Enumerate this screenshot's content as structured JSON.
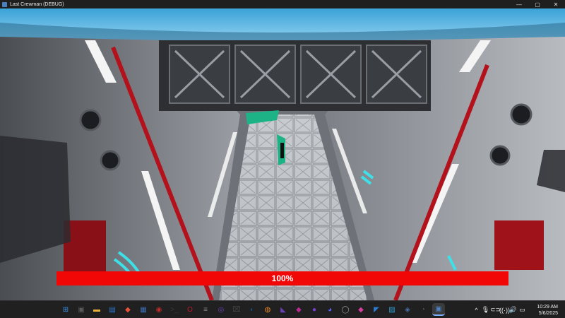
{
  "window": {
    "title": "Last Crewman (DEBUG)",
    "minimize": "—",
    "maximize": "▢",
    "close": "✕"
  },
  "hud": {
    "progress_label": "100%",
    "progress": 100,
    "bar_color": "#f20707"
  },
  "taskbar": {
    "icons": [
      {
        "name": "windows-start-icon",
        "glyph": "⊞",
        "color": "#3b8fe8"
      },
      {
        "name": "task-view-icon",
        "glyph": "▣",
        "color": "#5a5a5a"
      },
      {
        "name": "file-explorer-icon",
        "glyph": "▬",
        "color": "#e8b23b"
      },
      {
        "name": "notes-icon",
        "glyph": "▤",
        "color": "#2b79d6"
      },
      {
        "name": "brave-browser-icon",
        "glyph": "◆",
        "color": "#e8533b"
      },
      {
        "name": "calculator-icon",
        "glyph": "▦",
        "color": "#3c6fb5"
      },
      {
        "name": "app-red-icon",
        "glyph": "◉",
        "color": "#c22b2b"
      },
      {
        "name": "terminal-icon",
        "glyph": ">_",
        "color": "#3a3a3a"
      },
      {
        "name": "opera-icon",
        "glyph": "O",
        "color": "#c0172c"
      },
      {
        "name": "notepad-icon",
        "glyph": "≡",
        "color": "#8a8a8a"
      },
      {
        "name": "obs-icon",
        "glyph": "◎",
        "color": "#6a3fb5"
      },
      {
        "name": "capcut-icon",
        "glyph": "⌧",
        "color": "#444444"
      },
      {
        "name": "steam-icon",
        "glyph": "◐",
        "color": "#1b4b7a"
      },
      {
        "name": "blender-icon",
        "glyph": "◍",
        "color": "#e8872b"
      },
      {
        "name": "visual-studio-icon",
        "glyph": "◣",
        "color": "#6a3fb5"
      },
      {
        "name": "app-pink-icon",
        "glyph": "◆",
        "color": "#b52b8f"
      },
      {
        "name": "app-purple-icon",
        "glyph": "●",
        "color": "#7a3fd6"
      },
      {
        "name": "discord-icon",
        "glyph": "◕",
        "color": "#5865f2"
      },
      {
        "name": "app-grey-icon",
        "glyph": "◯",
        "color": "#9a9a9a"
      },
      {
        "name": "app-flame-icon",
        "glyph": "◆",
        "color": "#d63fa0"
      },
      {
        "name": "vscode-icon",
        "glyph": "◤",
        "color": "#2b7fd6"
      },
      {
        "name": "photos-icon",
        "glyph": "▨",
        "color": "#2b9fd6"
      },
      {
        "name": "app-robot-icon",
        "glyph": "◈",
        "color": "#4a6fa5"
      },
      {
        "name": "app-clock-icon",
        "glyph": "◔",
        "color": "#555555"
      },
      {
        "name": "last-crewman-icon",
        "glyph": "▣",
        "color": "#4a7fc1",
        "active": true
      }
    ]
  },
  "tray": {
    "chevron": "^",
    "mic": "🎙",
    "app": "⊂⊃",
    "wifi": "((·))",
    "volume": "🔊",
    "battery": "▭",
    "time": "10:29 AM",
    "date": "5/6/2025"
  }
}
